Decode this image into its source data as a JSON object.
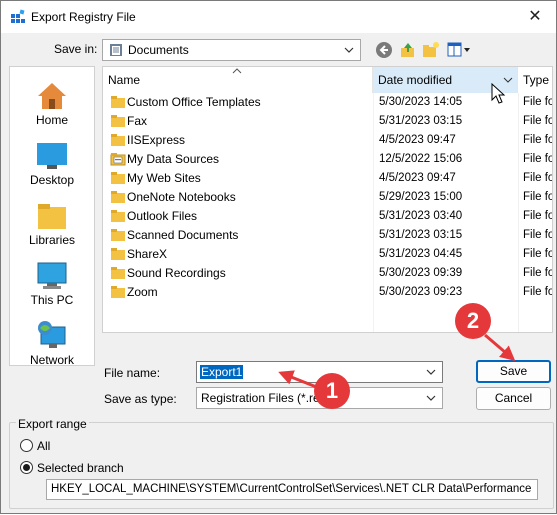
{
  "window": {
    "title": "Export Registry File",
    "close_glyph": "✕"
  },
  "location": {
    "label": "Save in:",
    "value": "Documents"
  },
  "toolbar": {
    "icons": [
      "back-icon",
      "up-folder-icon",
      "new-folder-icon",
      "view-menu-icon"
    ]
  },
  "places": [
    {
      "label": "Home",
      "icon": "home-icon"
    },
    {
      "label": "Desktop",
      "icon": "desktop-icon"
    },
    {
      "label": "Libraries",
      "icon": "libraries-icon"
    },
    {
      "label": "This PC",
      "icon": "this-pc-icon"
    },
    {
      "label": "Network",
      "icon": "network-icon"
    }
  ],
  "columns": {
    "name": "Name",
    "date": "Date modified",
    "type": "Type",
    "sorted_column": "date"
  },
  "files": [
    {
      "name": "Custom Office Templates",
      "date": "5/30/2023 14:05",
      "type": "File fo"
    },
    {
      "name": "Fax",
      "date": "5/31/2023 03:15",
      "type": "File fo"
    },
    {
      "name": "IISExpress",
      "date": "4/5/2023 09:47",
      "type": "File fo"
    },
    {
      "name": "My Data Sources",
      "date": "12/5/2022 15:06",
      "type": "File fo",
      "icon": "data-sources-folder"
    },
    {
      "name": "My Web Sites",
      "date": "4/5/2023 09:47",
      "type": "File fo"
    },
    {
      "name": "OneNote Notebooks",
      "date": "5/29/2023 15:00",
      "type": "File fo"
    },
    {
      "name": "Outlook Files",
      "date": "5/31/2023 03:40",
      "type": "File fo"
    },
    {
      "name": "Scanned Documents",
      "date": "5/31/2023 03:15",
      "type": "File fo"
    },
    {
      "name": "ShareX",
      "date": "5/31/2023 04:45",
      "type": "File fo"
    },
    {
      "name": "Sound Recordings",
      "date": "5/30/2023 09:39",
      "type": "File fo"
    },
    {
      "name": "Zoom",
      "date": "5/30/2023 09:23",
      "type": "File fo"
    }
  ],
  "form": {
    "filename_label": "File name:",
    "filename_value": "Export1",
    "type_label": "Save as type:",
    "type_value": "Registration Files (*.reg)",
    "save_label": "Save",
    "cancel_label": "Cancel"
  },
  "export_range": {
    "title": "Export range",
    "all_label": "All",
    "selected_label": "Selected branch",
    "selected": "selected_branch",
    "branch_path": "HKEY_LOCAL_MACHINE\\SYSTEM\\CurrentControlSet\\Services\\.NET CLR Data\\Performance"
  },
  "annotations": [
    {
      "number": "1"
    },
    {
      "number": "2"
    }
  ],
  "colors": {
    "accent": "#0067c0",
    "callout": "#e5383b",
    "sorted_header": "#d9ebf9",
    "folder": "#f4c242"
  }
}
